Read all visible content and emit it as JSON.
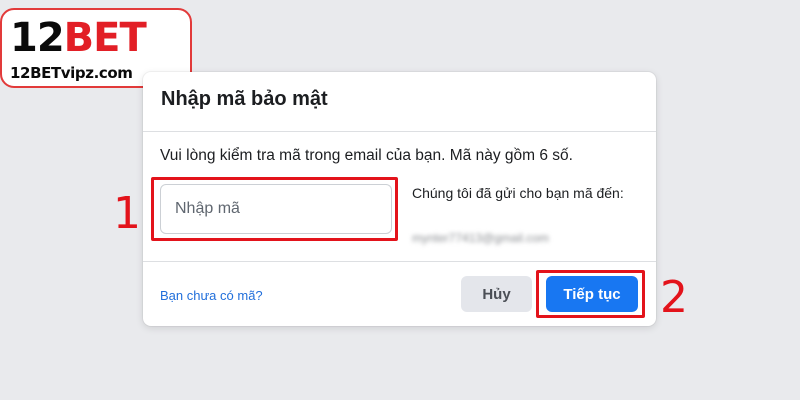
{
  "logo": {
    "brand_number": "12",
    "brand_word": "BET",
    "site": "12BETvipz.com"
  },
  "dialog": {
    "title": "Nhập mã bảo mật",
    "instruction": "Vui lòng kiểm tra mã trong email của bạn. Mã này gồm 6 số.",
    "code_input": {
      "placeholder": "Nhập mã",
      "value": ""
    },
    "sent_to_label": "Chúng tôi đã gửi cho bạn mã đến:",
    "email_obscured": "mynter77413@gmail.com",
    "no_code_link": "Bạn chưa có mã?",
    "cancel_label": "Hủy",
    "continue_label": "Tiếp tục"
  },
  "annotations": {
    "step_1": "1",
    "step_2": "2",
    "highlight_color": "#e3131b"
  },
  "colors": {
    "primary_button": "#1877f2",
    "link": "#216fdb",
    "background": "#e9eaed"
  }
}
